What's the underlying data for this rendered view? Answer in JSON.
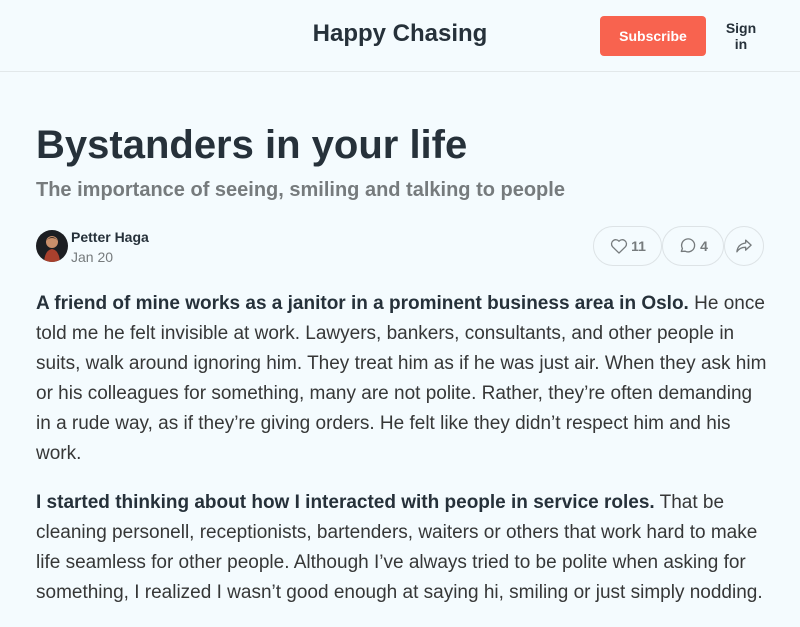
{
  "header": {
    "site_title": "Happy Chasing",
    "subscribe_label": "Subscribe",
    "signin_label": "Sign in"
  },
  "post": {
    "title": "Bystanders in your life",
    "subtitle": "The importance of seeing, smiling and talking to people",
    "author": "Petter Haga",
    "date": "Jan 20",
    "likes": "11",
    "comments": "4",
    "paragraphs": [
      {
        "lead": "A friend of mine works as a janitor in a prominent business area in Oslo.",
        "rest": " He once told me he felt invisible at work. Lawyers, bankers, consultants, and other people in suits, walk around ignoring him. They treat him as if he was just air. When they ask him or his colleagues for something, many are not polite. Rather, they’re often demanding in a rude way, as if they’re giving orders. He felt like they didn’t respect him and his work."
      },
      {
        "lead": "I started thinking about how I interacted with people in service roles.",
        "rest": " That be cleaning personell, receptionists, bartenders, waiters or others that work hard to make life seamless for other people. Although I’ve always tried to be polite when asking for something, I realized I wasn’t good enough at saying hi, smiling or just simply nodding."
      }
    ]
  },
  "icons": {
    "like": "heart-icon",
    "comment": "comment-bubble-icon",
    "share": "share-arrow-icon"
  },
  "colors": {
    "accent": "#f8634f",
    "background": "#f4fbfe",
    "heading": "#26313a",
    "muted": "#767b7d"
  }
}
